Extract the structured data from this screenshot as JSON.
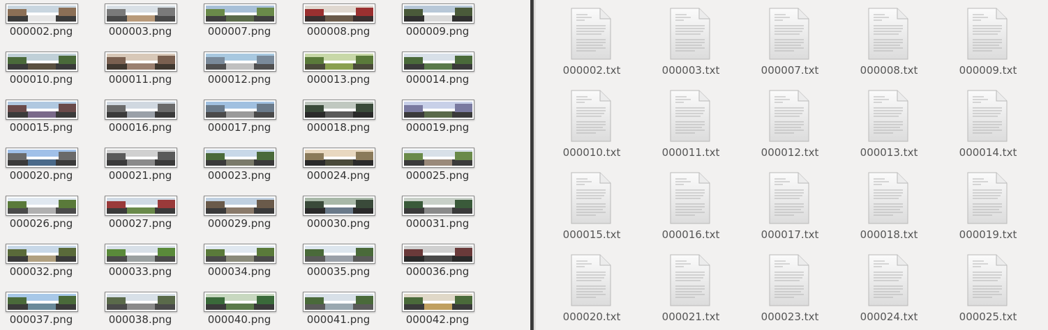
{
  "left_pane": {
    "files": [
      {
        "name": "000002.png",
        "palette": [
          "#c9d6e0",
          "#3b3b3b",
          "#8b6f56",
          "#e6e6e6"
        ]
      },
      {
        "name": "000003.png",
        "palette": [
          "#d9e0e6",
          "#4a4a4a",
          "#7a7a7a",
          "#b89a7a"
        ]
      },
      {
        "name": "000007.png",
        "palette": [
          "#a8c0d8",
          "#3f3f3f",
          "#6a8a4a",
          "#5a6a4a"
        ]
      },
      {
        "name": "000008.png",
        "palette": [
          "#e0d8d0",
          "#3a3030",
          "#9a3030",
          "#6a5a4a"
        ]
      },
      {
        "name": "000009.png",
        "palette": [
          "#b8c8d8",
          "#303030",
          "#4a5a3a",
          "#dadada"
        ]
      },
      {
        "name": "000010.png",
        "palette": [
          "#c0d0d8",
          "#3a3a3a",
          "#4a6a3a",
          "#5a5040"
        ]
      },
      {
        "name": "000011.png",
        "palette": [
          "#d8c8b8",
          "#403830",
          "#7a6050",
          "#9a8070"
        ]
      },
      {
        "name": "000012.png",
        "palette": [
          "#a8c8e0",
          "#505050",
          "#7a8a9a",
          "#c0c0c0"
        ]
      },
      {
        "name": "000013.png",
        "palette": [
          "#c8d8a8",
          "#4a4a3a",
          "#5a7a3a",
          "#8aa050"
        ]
      },
      {
        "name": "000014.png",
        "palette": [
          "#d8e0e8",
          "#3a3a3a",
          "#4a6a3a",
          "#5a7a4a"
        ]
      },
      {
        "name": "000015.png",
        "palette": [
          "#b0c8e0",
          "#3a3a3a",
          "#6a4a4a",
          "#7a6a8a"
        ]
      },
      {
        "name": "000016.png",
        "palette": [
          "#d0d8e0",
          "#3a3a3a",
          "#6a6a6a",
          "#9aa0a8"
        ]
      },
      {
        "name": "000017.png",
        "palette": [
          "#a0c0e0",
          "#4a4a4a",
          "#6a7a8a",
          "#9a9a9a"
        ]
      },
      {
        "name": "000018.png",
        "palette": [
          "#c0c8c0",
          "#2a2a2a",
          "#3a4a3a",
          "#5a5a5a"
        ]
      },
      {
        "name": "000019.png",
        "palette": [
          "#c8d0e8",
          "#3a3a3a",
          "#7a7aa0",
          "#5a6a4a"
        ]
      },
      {
        "name": "000020.png",
        "palette": [
          "#a0c0e8",
          "#3a3a3a",
          "#6a6a6a",
          "#4a6a8a"
        ]
      },
      {
        "name": "000021.png",
        "palette": [
          "#d0d0d0",
          "#3a3a3a",
          "#5a5a5a",
          "#8a8a8a"
        ]
      },
      {
        "name": "000023.png",
        "palette": [
          "#c8d8e8",
          "#3a3a3a",
          "#4a6a3a",
          "#7a7a6a"
        ]
      },
      {
        "name": "000024.png",
        "palette": [
          "#e8d8c0",
          "#2a2a2a",
          "#8a7a5a",
          "#4a4a3a"
        ]
      },
      {
        "name": "000025.png",
        "palette": [
          "#d8e0e8",
          "#3a3a3a",
          "#6a8a4a",
          "#9a8a7a"
        ]
      },
      {
        "name": "000026.png",
        "palette": [
          "#e0e8f0",
          "#4a4a4a",
          "#5a7a3a",
          "#b0b0b0"
        ]
      },
      {
        "name": "000027.png",
        "palette": [
          "#d0dae4",
          "#3a3a3a",
          "#9a3a3a",
          "#6a8a4a"
        ]
      },
      {
        "name": "000029.png",
        "palette": [
          "#c0d0e0",
          "#3a3a3a",
          "#6a5a4a",
          "#8a7a6a"
        ]
      },
      {
        "name": "000030.png",
        "palette": [
          "#a8b8a8",
          "#2a2a2a",
          "#3a4a3a",
          "#6a7a8a"
        ]
      },
      {
        "name": "000031.png",
        "palette": [
          "#c8d0c8",
          "#3a3a3a",
          "#3a5a3a",
          "#8a8a8a"
        ]
      },
      {
        "name": "000032.png",
        "palette": [
          "#c8d8e8",
          "#3a3a3a",
          "#5a6a3a",
          "#b0a080"
        ]
      },
      {
        "name": "000033.png",
        "palette": [
          "#d8e0e8",
          "#4a4a4a",
          "#5a8a3a",
          "#9aa0a0"
        ]
      },
      {
        "name": "000034.png",
        "palette": [
          "#e0e8f0",
          "#4a4a4a",
          "#5a7a3a",
          "#8a8a7a"
        ]
      },
      {
        "name": "000035.png",
        "palette": [
          "#dde6ee",
          "#5a5a5a",
          "#4a6a3a",
          "#9aa0a8"
        ]
      },
      {
        "name": "000036.png",
        "palette": [
          "#d0d0d0",
          "#2a2a2a",
          "#6a3a3a",
          "#4a4a4a"
        ]
      },
      {
        "name": "000037.png",
        "palette": [
          "#a8c8e8",
          "#3a3a3a",
          "#4a6a3a",
          "#6a8a9a"
        ]
      },
      {
        "name": "000038.png",
        "palette": [
          "#d8e0e8",
          "#4a4a4a",
          "#5a6a4a",
          "#8a8a8a"
        ]
      },
      {
        "name": "000040.png",
        "palette": [
          "#c8d8c0",
          "#3a3a3a",
          "#3a6a3a",
          "#5a7a4a"
        ]
      },
      {
        "name": "000041.png",
        "palette": [
          "#d8e0e8",
          "#5a5a5a",
          "#4a6a3a",
          "#9aa8b0"
        ]
      },
      {
        "name": "000042.png",
        "palette": [
          "#e0d8c8",
          "#3a3a3a",
          "#4a6a3a",
          "#c0a060"
        ]
      }
    ]
  },
  "right_pane": {
    "files": [
      "000002.txt",
      "000003.txt",
      "000007.txt",
      "000008.txt",
      "000009.txt",
      "000010.txt",
      "000011.txt",
      "000012.txt",
      "000013.txt",
      "000014.txt",
      "000015.txt",
      "000016.txt",
      "000017.txt",
      "000018.txt",
      "000019.txt",
      "000020.txt",
      "000021.txt",
      "000023.txt",
      "000024.txt",
      "000025.txt"
    ],
    "icon": "text-document-icon"
  }
}
